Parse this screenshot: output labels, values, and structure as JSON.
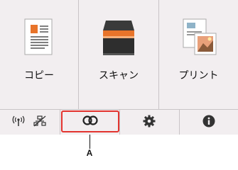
{
  "menu": {
    "items": [
      {
        "id": "copy",
        "label": "コピー",
        "icon": "copy-document-icon"
      },
      {
        "id": "scan",
        "label": "スキャン",
        "icon": "scanner-icon"
      },
      {
        "id": "print",
        "label": "プリント",
        "icon": "print-photo-icon"
      }
    ]
  },
  "status_bar": {
    "wireless_icon": "wireless-lan-icon",
    "wired_icon": "wired-lan-disabled-icon",
    "connect_icon": "link-icon",
    "settings_icon": "gear-icon",
    "info_icon": "info-icon"
  },
  "callout": {
    "letter": "A"
  },
  "colors": {
    "highlight": "#e3342f",
    "background": "#f2eef0",
    "accent": "#e8742a"
  }
}
